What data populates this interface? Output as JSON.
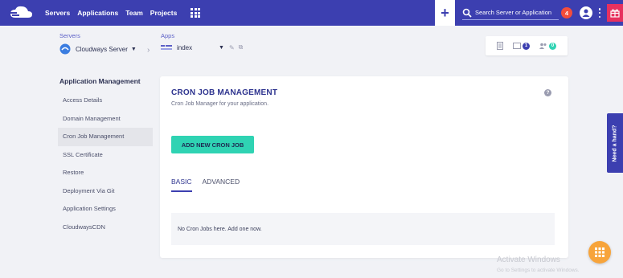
{
  "nav": {
    "items": [
      {
        "label": "Servers"
      },
      {
        "label": "Applications"
      },
      {
        "label": "Team"
      },
      {
        "label": "Projects"
      }
    ],
    "search_placeholder": "Search Server or Application",
    "notification_count": "4",
    "colors": {
      "bar": "#3c3fb0",
      "notification": "#f44d3b",
      "gift": "#e7315f"
    }
  },
  "breadcrumb": {
    "servers_label": "Servers",
    "server_name": "Cloudways Server",
    "apps_label": "Apps",
    "app_name": "index"
  },
  "utilities": {
    "notes_count": "1",
    "users_count": "0"
  },
  "sidebar": {
    "title": "Application Management",
    "items": [
      {
        "label": "Access Details"
      },
      {
        "label": "Domain Management"
      },
      {
        "label": "Cron Job Management",
        "active": true
      },
      {
        "label": "SSL Certificate"
      },
      {
        "label": "Restore"
      },
      {
        "label": "Deployment Via Git"
      },
      {
        "label": "Application Settings"
      },
      {
        "label": "CloudwaysCDN"
      }
    ]
  },
  "main": {
    "title": "CRON JOB MANAGEMENT",
    "subtitle": "Cron Job Manager for your application.",
    "help_icon": "?",
    "add_button": "ADD NEW CRON JOB",
    "tabs": [
      {
        "label": "BASIC",
        "active": true
      },
      {
        "label": "ADVANCED"
      }
    ],
    "empty_message": "No Cron Jobs here. Add one now.",
    "accent_button_color": "#2fd3b3"
  },
  "help_tab": "Need a hand?",
  "watermark": {
    "line1": "Activate Windows",
    "line2": "Go to Settings to activate Windows."
  }
}
